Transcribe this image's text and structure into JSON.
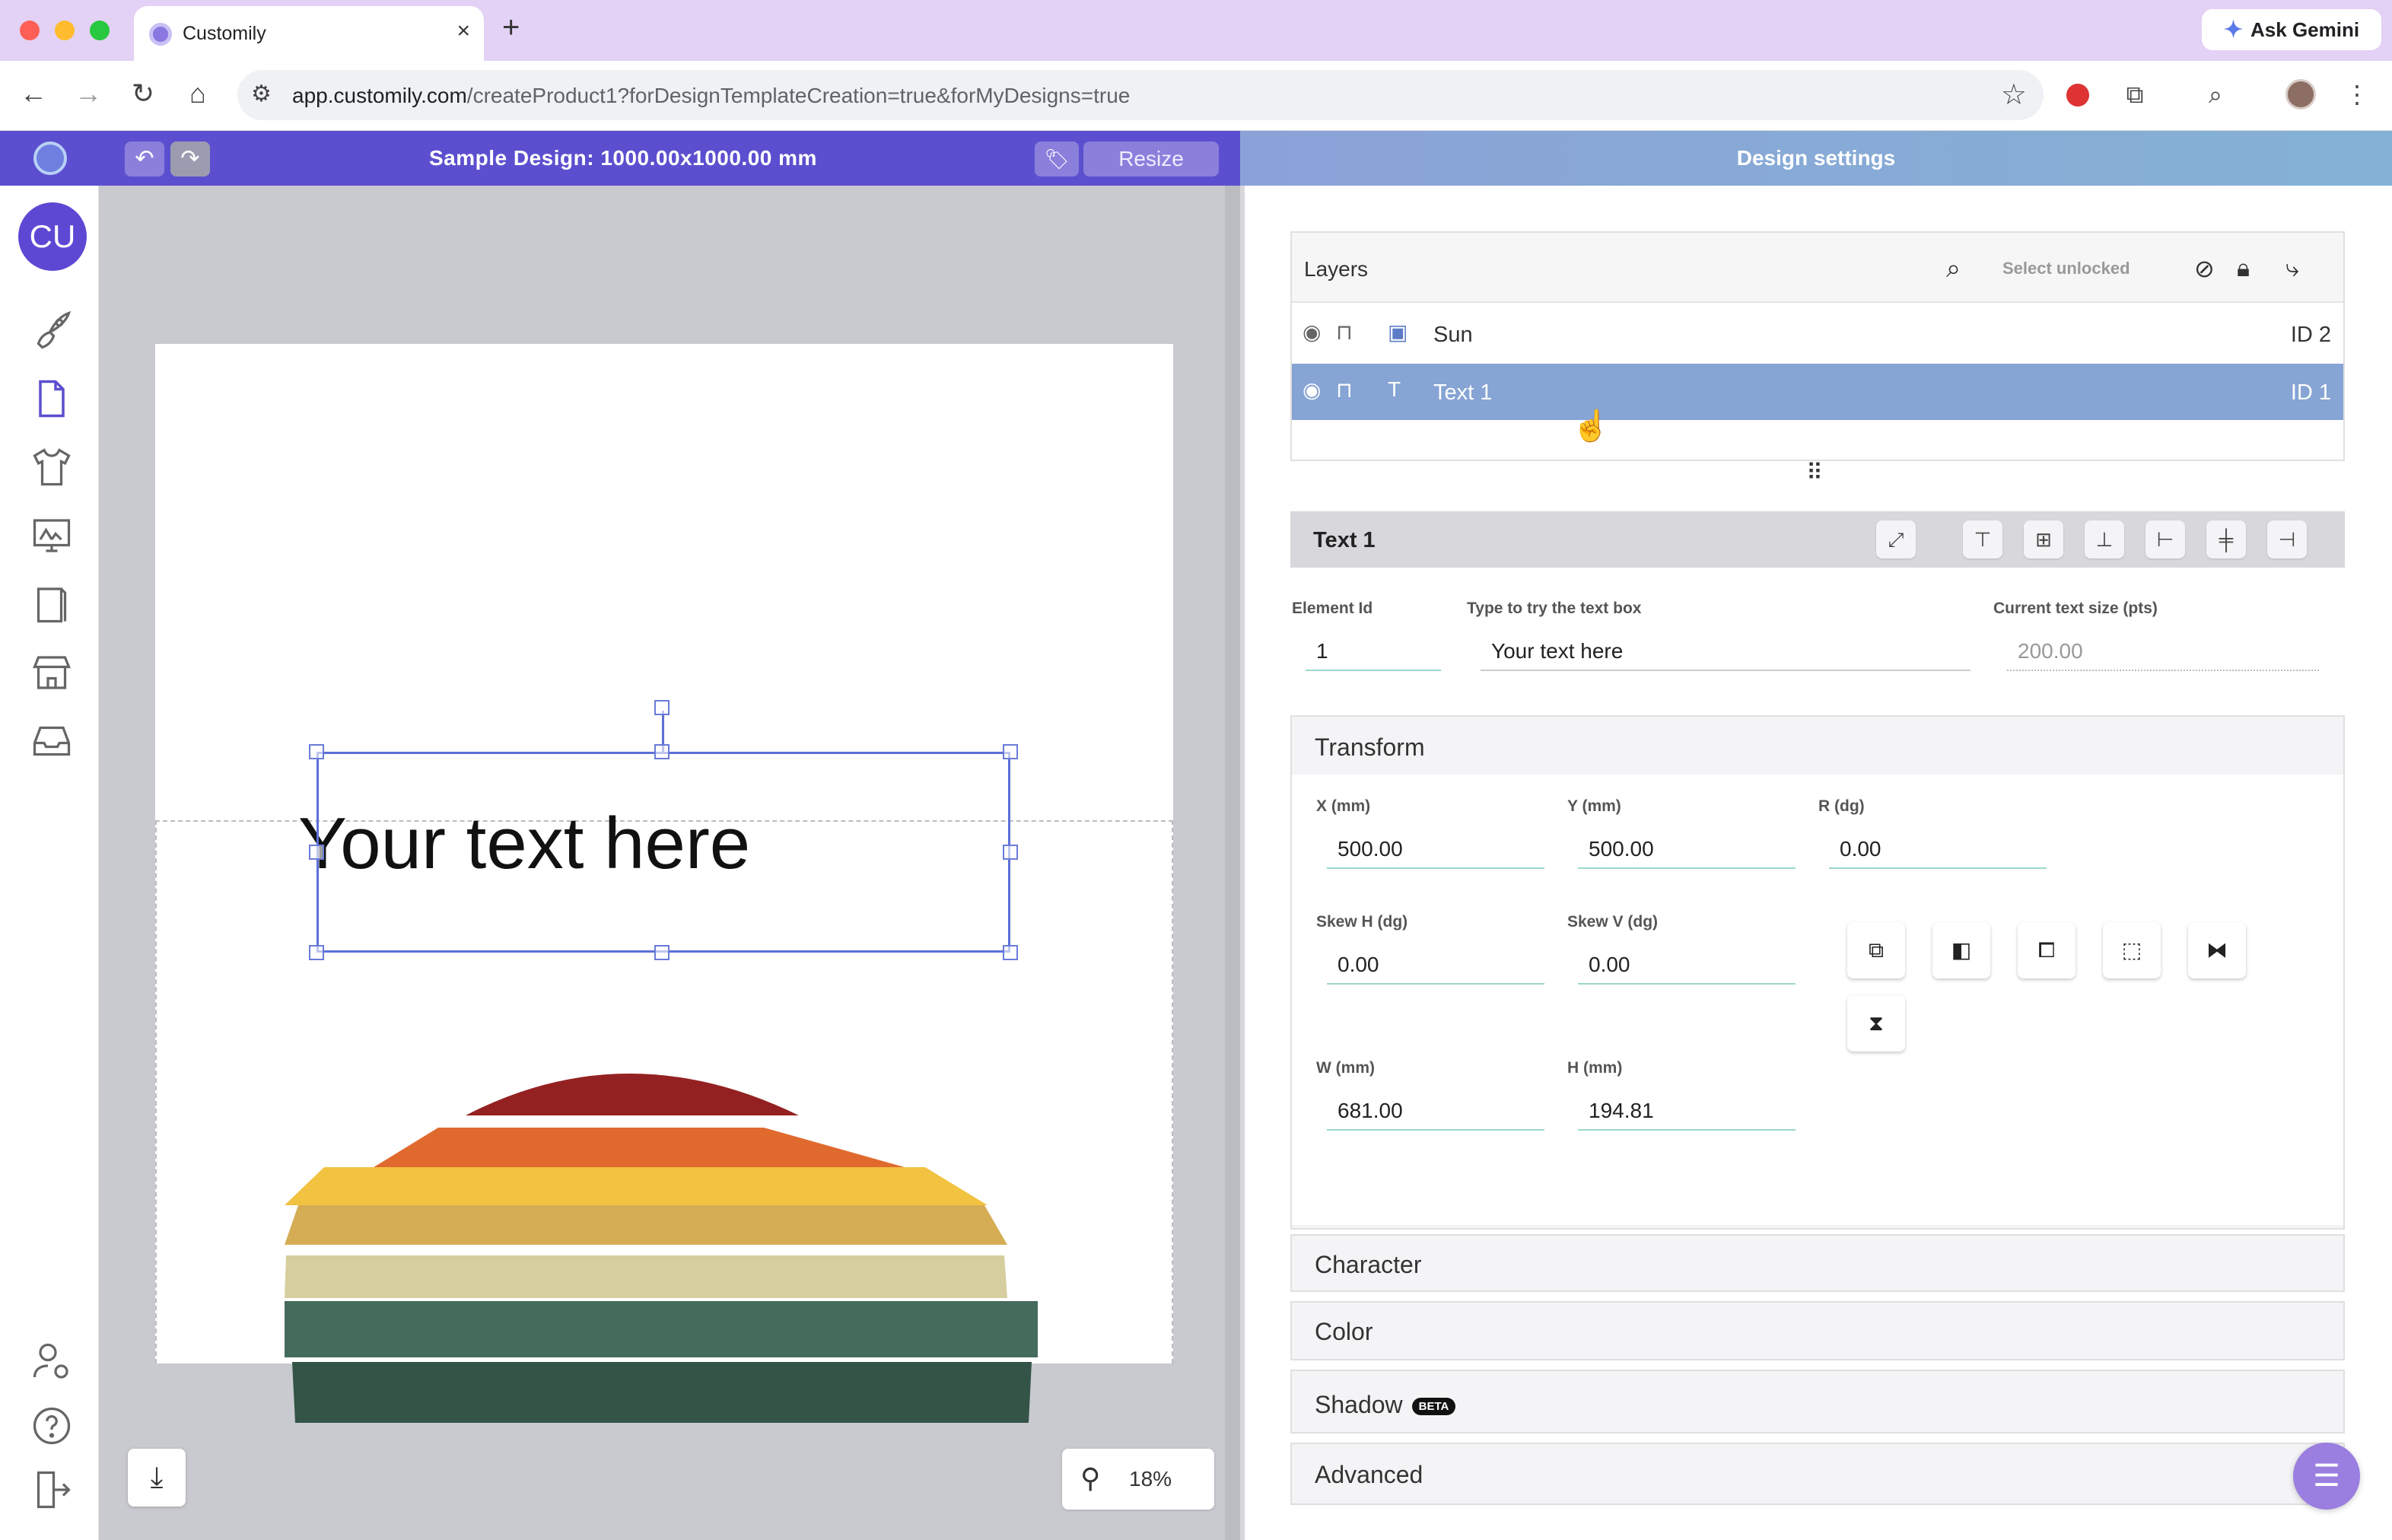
{
  "browser": {
    "tab_title": "Customily",
    "tab_close": "×",
    "new_tab": "+",
    "ask_gemini": "Ask Gemini",
    "url_host": "app.customily.com",
    "url_path": "/createProduct1?forDesignTemplateCreation=true&forMyDesigns=true",
    "traffic_colors": [
      "#ff5f57",
      "#febc2e",
      "#28c840"
    ]
  },
  "app_header": {
    "design_title": "Sample Design: 1000.00x1000.00 mm",
    "resize_label": "Resize",
    "settings_title": "Design settings"
  },
  "sidebar": {
    "avatar_initials": "CU",
    "icons": [
      "rocket-icon",
      "document-icon",
      "tshirt-icon",
      "gallery-icon",
      "book-icon",
      "store-icon",
      "inbox-icon",
      "user-settings-icon",
      "help-icon",
      "logout-icon"
    ]
  },
  "canvas": {
    "text": "Your text here",
    "zoom": "18%",
    "sun_colors": [
      "#942121",
      "#e06a2e",
      "#f2c241",
      "#d5ad55",
      "#d6ce9e",
      "#456b5c",
      "#335446"
    ]
  },
  "layers": {
    "title": "Layers",
    "select_unlocked": "Select unlocked",
    "items": [
      {
        "name": "Sun",
        "id": "ID 2",
        "type": "image",
        "selected": false
      },
      {
        "name": "Text 1",
        "id": "ID 1",
        "type": "text",
        "selected": true
      }
    ]
  },
  "element": {
    "title": "Text 1",
    "element_id_label": "Element Id",
    "element_id": "1",
    "textbox_label": "Type to try the text box",
    "textbox_value": "Your text here",
    "text_size_label": "Current text size (pts)",
    "text_size": "200.00"
  },
  "transform": {
    "title": "Transform",
    "x_label": "X (mm)",
    "x": "500.00",
    "y_label": "Y (mm)",
    "y": "500.00",
    "r_label": "R (dg)",
    "r": "0.00",
    "skew_h_label": "Skew H (dg)",
    "skew_h": "0.00",
    "skew_v_label": "Skew V (dg)",
    "skew_v": "0.00",
    "w_label": "W (mm)",
    "w": "681.00",
    "h_label": "H (mm)",
    "h": "194.81"
  },
  "sections": {
    "character": "Character",
    "color": "Color",
    "shadow": "Shadow",
    "shadow_badge": "BETA",
    "advanced": "Advanced"
  },
  "colors": {
    "header_purple": "#5c4fcf",
    "selection_blue": "#86a4d4",
    "input_underline": "#9bd8cc"
  }
}
